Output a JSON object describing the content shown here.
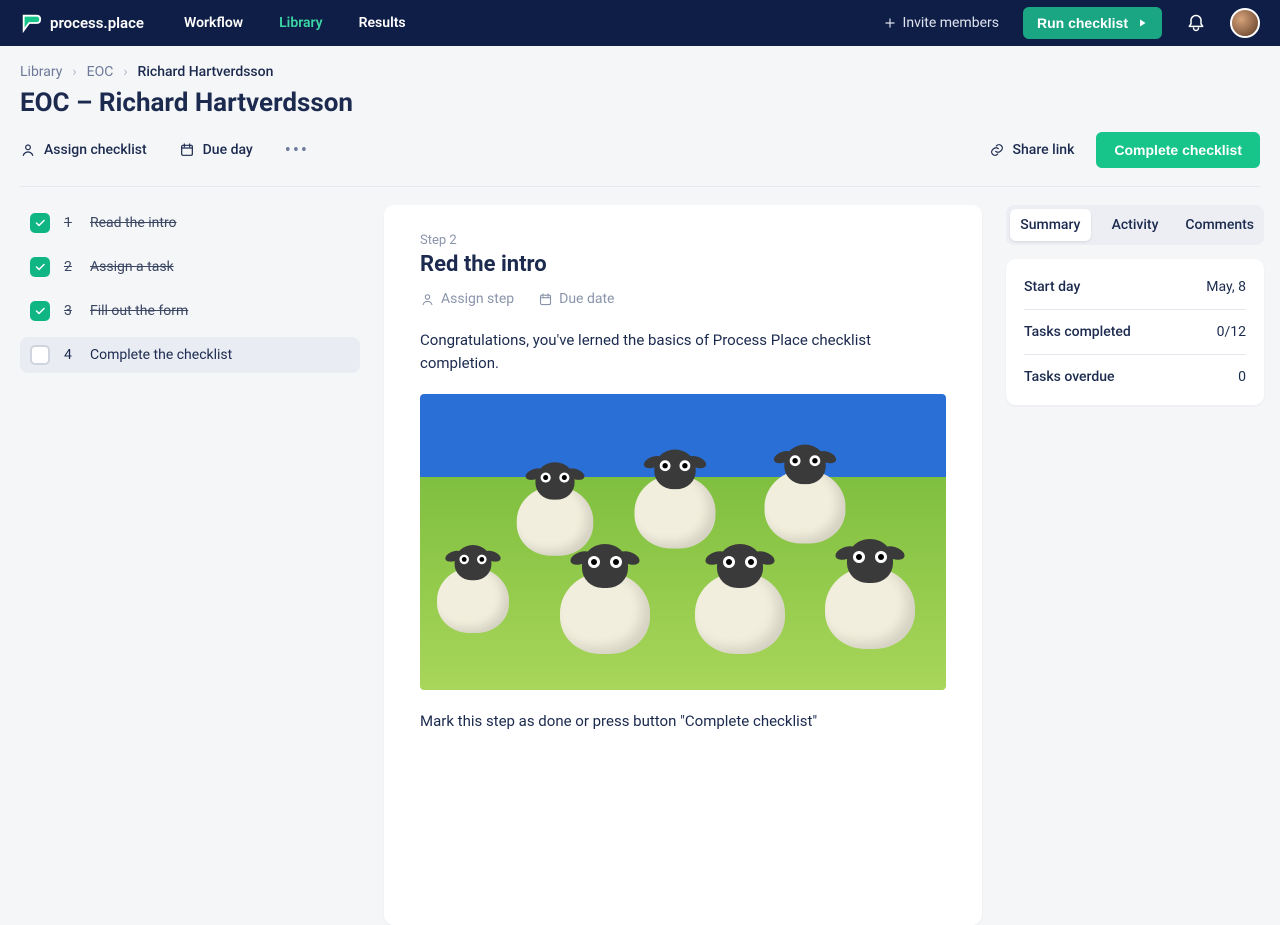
{
  "brand": "process.place",
  "nav": {
    "items": [
      "Workflow",
      "Library",
      "Results"
    ],
    "active_index": 1,
    "invite": "Invite members",
    "run": "Run checklist"
  },
  "breadcrumbs": [
    "Library",
    "EOC",
    "Richard Hartverdsson"
  ],
  "page_title": "EOC – Richard Hartverdsson",
  "toolbar": {
    "assign": "Assign checklist",
    "due": "Due day",
    "share": "Share link",
    "complete": "Complete checklist"
  },
  "steps": [
    {
      "num": "1",
      "label": "Read the intro",
      "done": true,
      "selected": false
    },
    {
      "num": "2",
      "label": "Assign a task",
      "done": true,
      "selected": false
    },
    {
      "num": "3",
      "label": "Fill out the form",
      "done": true,
      "selected": false
    },
    {
      "num": "4",
      "label": "Complete the checklist",
      "done": false,
      "selected": true
    }
  ],
  "detail": {
    "step_tag": "Step 2",
    "title": "Red the intro",
    "assign": "Assign step",
    "due": "Due date",
    "para1": "Congratulations, you've lerned the basics of Process Place checklist completion.",
    "para2": "Mark this step as done or press button \"Complete checklist\"",
    "image_alt": "cartoon sheep group"
  },
  "side_tabs": [
    "Summary",
    "Activity",
    "Comments"
  ],
  "side_active": 0,
  "summary": [
    {
      "label": "Start day",
      "value": "May, 8"
    },
    {
      "label": "Tasks completed",
      "value": "0/12"
    },
    {
      "label": "Tasks overdue",
      "value": "0"
    }
  ]
}
